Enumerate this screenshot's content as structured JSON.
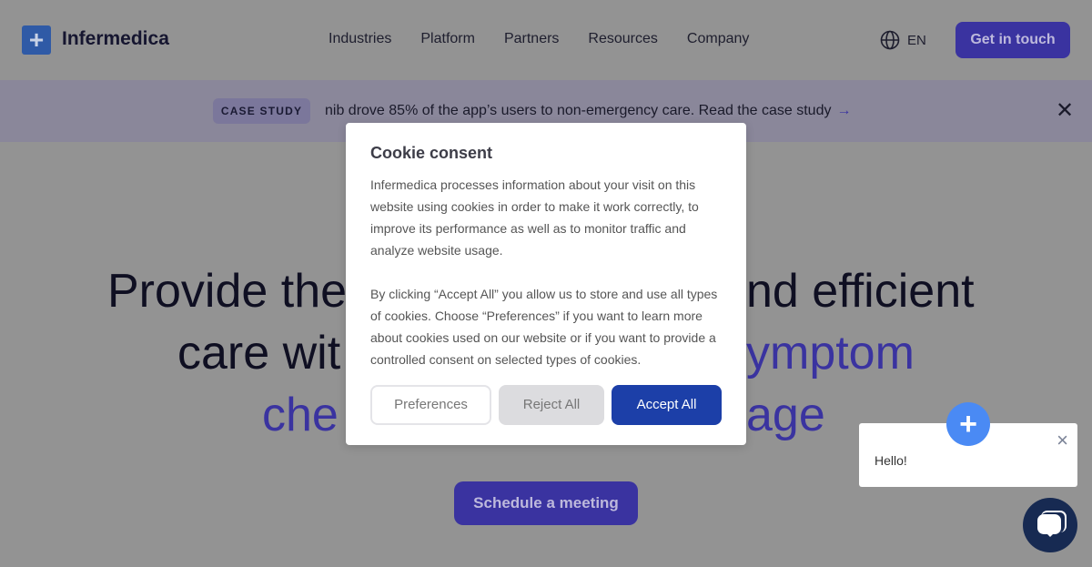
{
  "header": {
    "logo": "Infermedica",
    "nav": [
      "Industries",
      "Platform",
      "Partners",
      "Resources",
      "Company"
    ],
    "language": "EN",
    "cta": "Get in touch"
  },
  "banner": {
    "badge": "CASE STUDY",
    "text": "nib drove 85% of the app’s users to non-emergency care. Read the case study",
    "arrow": "→"
  },
  "hero": {
    "line1_left": "Provide the",
    "line1_right": "nd efficient",
    "line2_left": "care wit",
    "line2_right": "ymptom",
    "line3_left": "che",
    "line3_right": "age",
    "cta": "Schedule a meeting"
  },
  "colors": {
    "accent": "#3a33a0",
    "accept": "#1c3fa8",
    "chat": "#4a8af4"
  },
  "cookie": {
    "title": "Cookie consent",
    "para1": "Infermedica processes information about your visit on this website using cookies in order to make it work correctly, to improve its performance as well as to monitor traffic and analyze website usage.",
    "para2": "By clicking “Accept All” you allow us to store and use all types of cookies. Choose “Preferences” if you want to learn more about cookies used on our website or if you want to provide a controlled consent on selected types of cookies.",
    "preferences": "Preferences",
    "reject": "Reject All",
    "accept": "Accept All"
  },
  "chat": {
    "greeting": "Hello!"
  }
}
